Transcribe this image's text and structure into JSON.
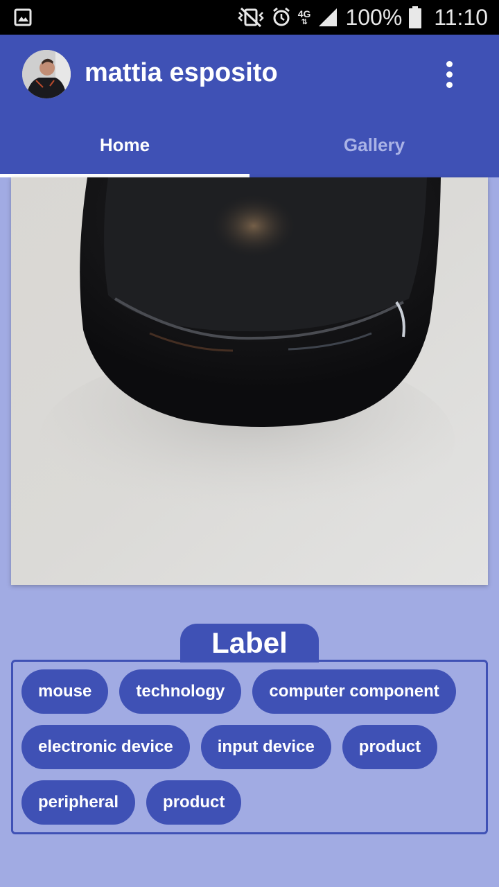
{
  "status_bar": {
    "network_label": "4G",
    "battery_percent": "100%",
    "time": "11:10",
    "icons": [
      "gallery-notification-icon",
      "vibrate-icon",
      "alarm-icon",
      "network-4g-icon",
      "signal-icon",
      "battery-icon"
    ]
  },
  "app_bar": {
    "title": "mattia esposito",
    "avatar": "avatar",
    "menu_icon": "more-vert-icon",
    "color": "#3f51b5"
  },
  "tabs": [
    {
      "label": "Home",
      "selected": true
    },
    {
      "label": "Gallery",
      "selected": false
    }
  ],
  "photo": {
    "subject": "mouse-photo"
  },
  "labels_section": {
    "title": "Label",
    "chips": [
      "mouse",
      "technology",
      "computer component",
      "electronic device",
      "input device",
      "product",
      "peripheral",
      "product"
    ]
  },
  "colors": {
    "primary": "#3f51b5",
    "background": "#a1abe3",
    "inactive_tab": "#aab3e6"
  }
}
